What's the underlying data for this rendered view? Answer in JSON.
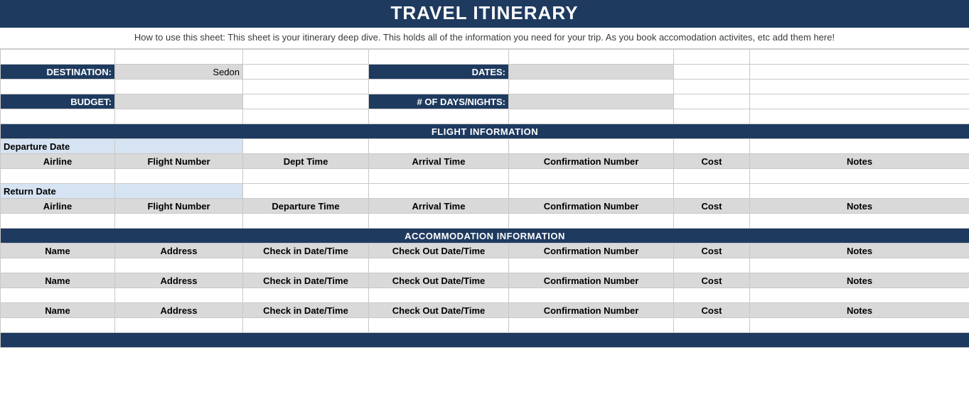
{
  "title": "TRAVEL ITINERARY",
  "instructions": "How to use this sheet: This sheet is your itinerary deep dive. This holds all of the information you need for your trip. As you book accomodation activites, etc add them here!",
  "meta": {
    "destination_label": "DESTINATION:",
    "destination_value": "Sedon",
    "dates_label": "DATES:",
    "dates_value": "",
    "budget_label": "BUDGET:",
    "budget_value": "",
    "days_label": "# OF DAYS/NIGHTS:",
    "days_value": ""
  },
  "flight": {
    "section_title": "FLIGHT INFORMATION",
    "departure_label": "Departure Date",
    "return_label": "Return Date",
    "headers_dep": {
      "airline": "Airline",
      "flight_no": "Flight Number",
      "dept_time": "Dept Time",
      "arrival_time": "Arrival Time",
      "confirmation": "Confirmation Number",
      "cost": "Cost",
      "notes": "Notes"
    },
    "headers_ret": {
      "airline": "Airline",
      "flight_no": "Flight Number",
      "dept_time": "Departure Time",
      "arrival_time": "Arrival Time",
      "confirmation": "Confirmation Number",
      "cost": "Cost",
      "notes": "Notes"
    }
  },
  "accom": {
    "section_title": "ACCOMMODATION INFORMATION",
    "headers": {
      "name": "Name",
      "address": "Address",
      "checkin": "Check in Date/Time",
      "checkout": "Check Out Date/Time",
      "confirmation": "Confirmation Number",
      "cost": "Cost",
      "notes": "Notes"
    }
  }
}
